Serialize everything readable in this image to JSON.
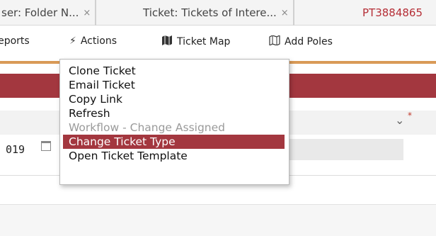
{
  "tabs": [
    {
      "label": "ser: Folder N...",
      "close": "×"
    },
    {
      "label": "Ticket: Tickets of Intere...",
      "close": "×"
    },
    {
      "label": "PT3884865"
    }
  ],
  "toolbar": {
    "reports_label": "Reports",
    "actions_icon": "⚡",
    "actions_label": "Actions",
    "ticket_map_icon": "map-icon",
    "ticket_map_label": "Ticket Map",
    "add_poles_icon": "map-outline-icon",
    "add_poles_label": "Add Poles"
  },
  "actions_menu": {
    "items": [
      {
        "label": "Clone Ticket",
        "state": "normal"
      },
      {
        "label": "Email Ticket",
        "state": "normal"
      },
      {
        "label": "Copy Link",
        "state": "normal"
      },
      {
        "label": "Refresh",
        "state": "normal"
      },
      {
        "label": "Workflow - Change Assigned",
        "state": "disabled"
      },
      {
        "label": "Change Ticket Type",
        "state": "selected"
      },
      {
        "label": "Open Ticket Template",
        "state": "normal"
      }
    ]
  },
  "form": {
    "date_value": "019",
    "required_marker": "*",
    "dropdown_chevron": "⌄"
  },
  "colors": {
    "accent_red": "#a3373f",
    "tab_active_text": "#b52e36",
    "orange_line": "#d99a57"
  }
}
